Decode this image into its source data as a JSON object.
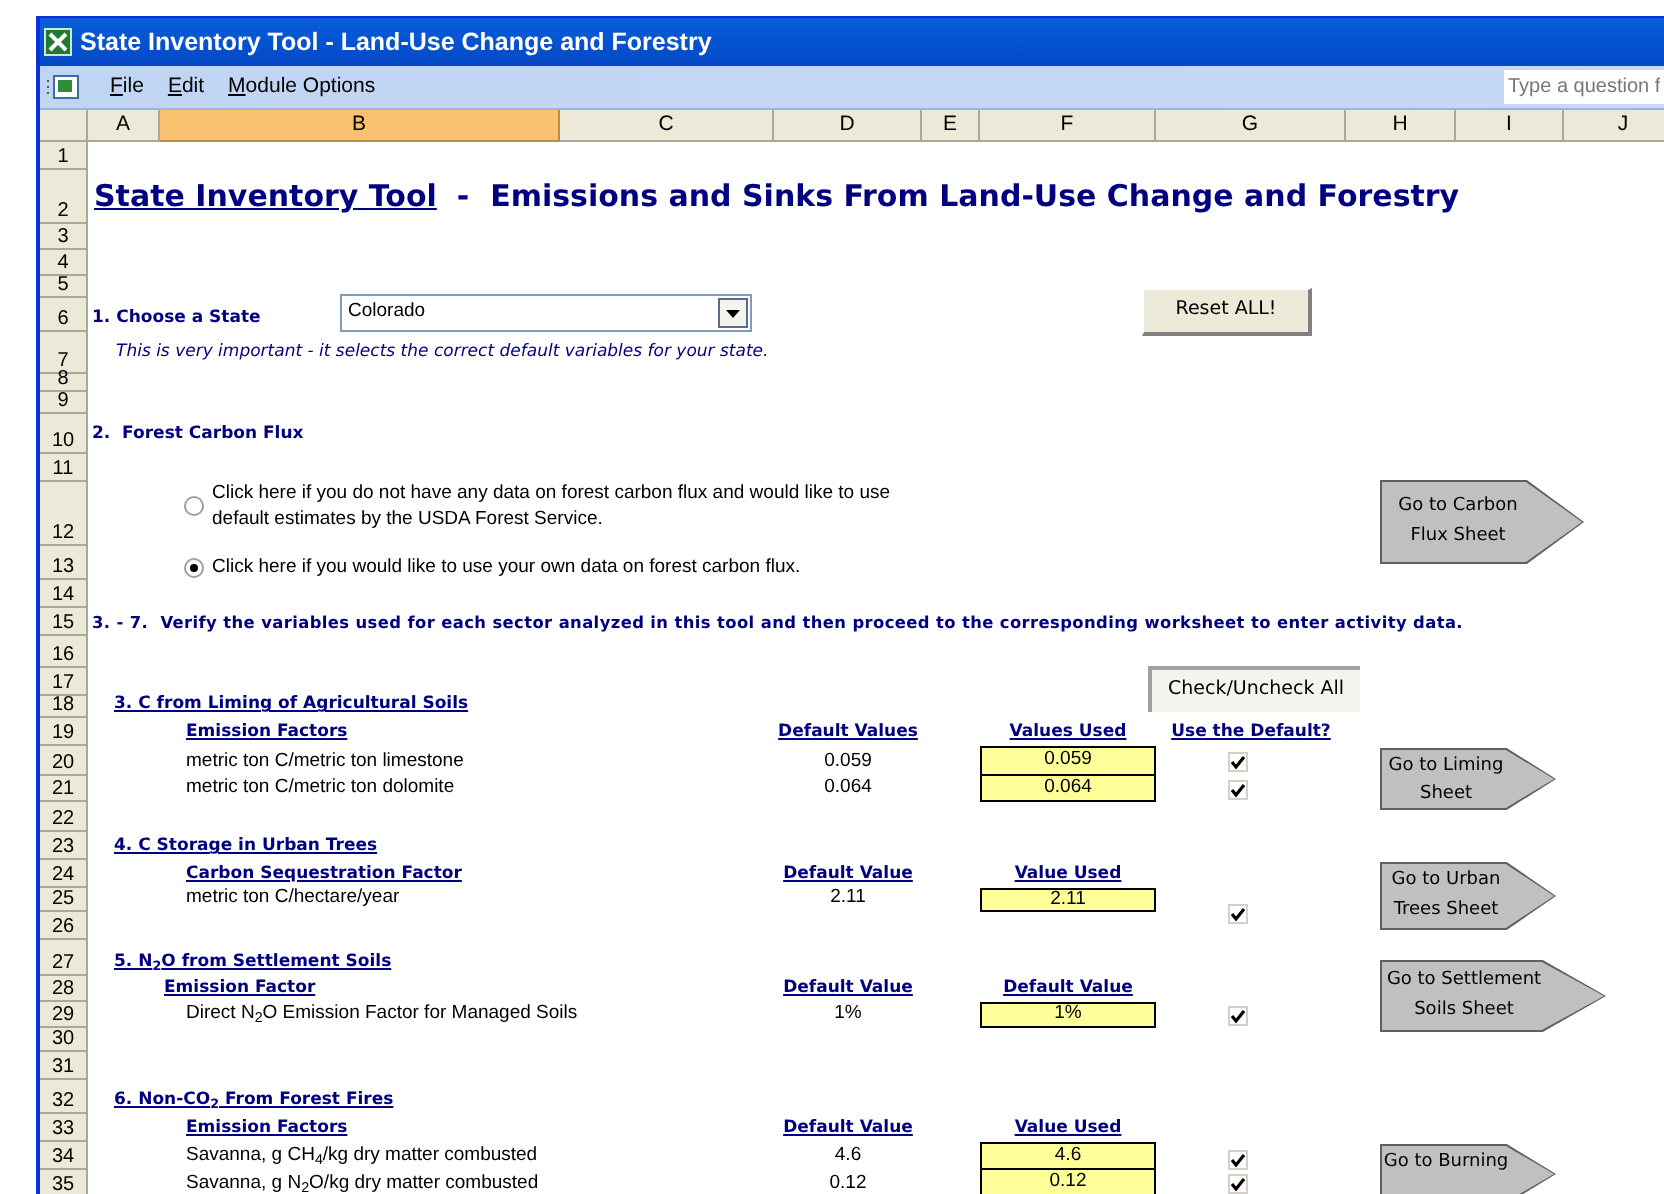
{
  "window": {
    "title": "State Inventory Tool - Land-Use Change and Forestry"
  },
  "menu": [
    "File",
    "Edit",
    "Module Options"
  ],
  "help_search": {
    "placeholder": "Type a question f"
  },
  "columns": [
    {
      "label": "A",
      "selected": false
    },
    {
      "label": "B",
      "selected": true
    },
    {
      "label": "C",
      "selected": false
    },
    {
      "label": "D",
      "selected": false
    },
    {
      "label": "E",
      "selected": false
    },
    {
      "label": "F",
      "selected": false
    },
    {
      "label": "G",
      "selected": false
    },
    {
      "label": "H",
      "selected": false
    },
    {
      "label": "I",
      "selected": false
    },
    {
      "label": "J",
      "selected": false
    }
  ],
  "rows": [
    "1",
    "2",
    "3",
    "4",
    "5",
    "6",
    "7",
    "8",
    "9",
    "10",
    "11",
    "12",
    "13",
    "14",
    "15",
    "16",
    "17",
    "18",
    "19",
    "20",
    "21",
    "22",
    "23",
    "24",
    "25",
    "26",
    "27",
    "28",
    "29",
    "30",
    "31",
    "32",
    "33",
    "34",
    "35"
  ],
  "heading": {
    "link": "State Inventory Tool",
    "rest": "-  Emissions and Sinks From Land-Use Change and Forestry"
  },
  "step1": {
    "label": "1. Choose a State",
    "state": "Colorado",
    "note": "This is very important - it selects the correct default variables for your state.",
    "reset_button": "Reset ALL!"
  },
  "step2": {
    "label": "2.  Forest Carbon Flux",
    "options": [
      {
        "label": "Click here if you do not have any data on forest carbon flux and would like to use default estimates by the USDA Forest Service.",
        "selected": false
      },
      {
        "label": "Click here if you would like to use your own data on forest carbon flux.",
        "selected": true
      }
    ],
    "goto_button": "Go to Carbon Flux Sheet"
  },
  "steps3_7": {
    "label": "3. - 7.  Verify the variables used for each sector analyzed in this tool and then proceed to the corresponding worksheet to enter activity data.",
    "check_all_button": "Check/Uncheck All"
  },
  "sectors": [
    {
      "title": "3. C from Liming of Agricultural Soils",
      "factor_heading": "Emission Factors",
      "default_heading": "Default Values",
      "used_heading": "Values Used",
      "use_default_heading": "Use the Default?",
      "goto_button": "Go to Liming Sheet",
      "rows": [
        {
          "label": "metric ton C/metric ton limestone",
          "default": "0.059",
          "used": "0.059",
          "use_default": true
        },
        {
          "label": "metric ton C/metric ton dolomite",
          "default": "0.064",
          "used": "0.064",
          "use_default": true
        }
      ]
    },
    {
      "title": "4. C Storage in Urban Trees",
      "factor_heading": "Carbon Sequestration Factor",
      "default_heading": "Default Value",
      "used_heading": "Value Used",
      "goto_button": "Go to Urban Trees Sheet",
      "rows": [
        {
          "label": "metric ton C/hectare/year",
          "default": "2.11",
          "used": "2.11",
          "use_default": true
        }
      ]
    },
    {
      "title": "5. N$_{2}$O from Settlement Soils",
      "factor_heading": "Emission Factor",
      "default_heading": "Default Value",
      "used_heading": "Default Value",
      "goto_button": "Go to Settlement Soils Sheet",
      "rows": [
        {
          "label": "Direct N$_{2}$O Emission Factor for Managed Soils",
          "default": "1%",
          "used": "1%",
          "use_default": true
        }
      ]
    },
    {
      "title": "6. Non-CO$_{2}$ From Forest Fires",
      "factor_heading": "Emission Factors",
      "default_heading": "Default Value",
      "used_heading": "Value Used",
      "goto_button": "Go to Burning",
      "rows": [
        {
          "label": "Savanna, g CH$_{4}$/kg dry matter combusted",
          "default": "4.6",
          "used": "4.6",
          "use_default": true
        },
        {
          "label": "Savanna, g N$_{2}$O/kg dry matter combusted",
          "default": "0.12",
          "used": "0.12",
          "use_default": true
        }
      ]
    }
  ]
}
